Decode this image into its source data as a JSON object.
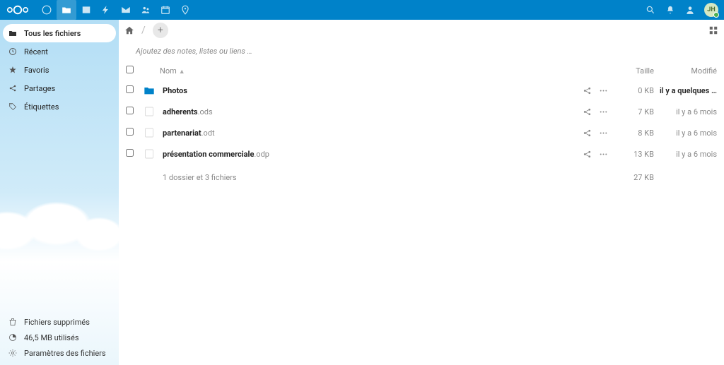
{
  "avatar": "JH",
  "sidebar": {
    "items": [
      {
        "label": "Tous les fichiers"
      },
      {
        "label": "Récent"
      },
      {
        "label": "Favoris"
      },
      {
        "label": "Partages"
      },
      {
        "label": "Étiquettes"
      }
    ],
    "bottom": [
      {
        "label": "Fichiers supprimés"
      },
      {
        "label": "46,5 MB utilisés"
      },
      {
        "label": "Paramètres des fichiers"
      }
    ]
  },
  "notes_placeholder": "Ajoutez des notes, listes ou liens …",
  "columns": {
    "name": "Nom",
    "size": "Taille",
    "modified": "Modifié"
  },
  "files": [
    {
      "name": "Photos",
      "ext": "",
      "size": "0 KB",
      "modified": "il y a quelques …",
      "type": "folder"
    },
    {
      "name": "adherents",
      "ext": ".ods",
      "size": "7 KB",
      "modified": "il y a 6 mois",
      "type": "sheet"
    },
    {
      "name": "partenariat",
      "ext": ".odt",
      "size": "8 KB",
      "modified": "il y a 6 mois",
      "type": "doc"
    },
    {
      "name": "présentation commerciale",
      "ext": ".odp",
      "size": "13 KB",
      "modified": "il y a 6 mois",
      "type": "pres"
    }
  ],
  "summary": {
    "text": "1 dossier et 3 fichiers",
    "size": "27 KB"
  }
}
